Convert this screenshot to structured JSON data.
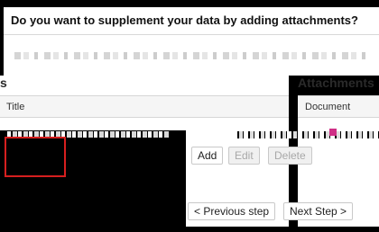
{
  "header": {
    "question": "Do you want to supplement your data by adding attachments?"
  },
  "left": {
    "heading_fragment": "s",
    "column_title": "Title"
  },
  "attachments": {
    "heading": "Attachments",
    "column_document": "Document"
  },
  "actions": {
    "add": "Add",
    "edit": "Edit",
    "delete": "Delete"
  },
  "navigation": {
    "previous": "< Previous step",
    "next": "Next Step >"
  },
  "colors": {
    "highlight": "#d61f1f",
    "accent": "#cf2f86"
  }
}
